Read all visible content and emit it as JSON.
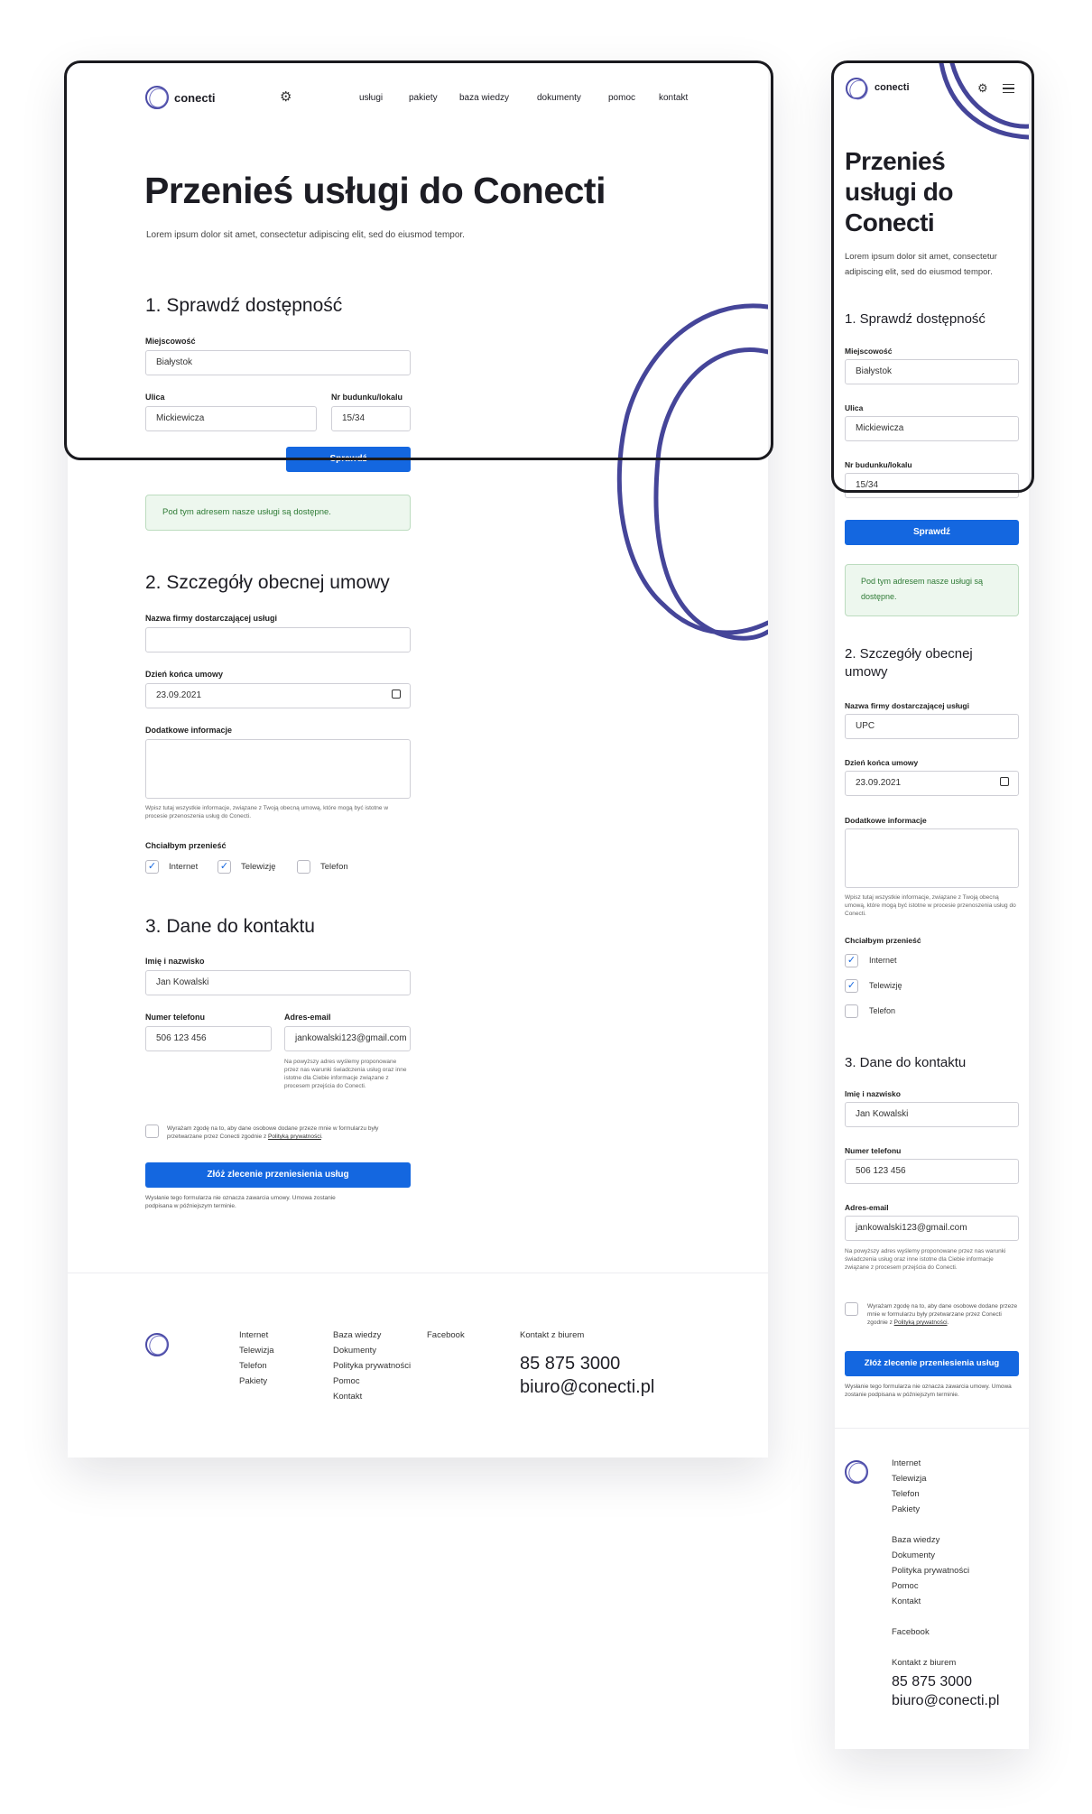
{
  "brand": {
    "name": "conecti",
    "accent": "#1467e0",
    "scribble": "#454599"
  },
  "nav": [
    "usługi",
    "pakiety",
    "baza wiedzy",
    "dokumenty",
    "pomoc",
    "kontakt"
  ],
  "icons": {
    "settings": "gear-icon",
    "menu": "hamburger-icon",
    "calendar": "calendar-icon"
  },
  "hero": {
    "title": "Przenieś usługi do Conecti",
    "lead": "Lorem ipsum dolor sit amet, consectetur adipiscing elit, sed do eiusmod tempor."
  },
  "section1": {
    "title": "1. Sprawdź dostępność",
    "city_label": "Miejscowość",
    "city_value": "Białystok",
    "street_label": "Ulica",
    "street_value": "Mickiewicza",
    "number_label": "Nr budunku/lokalu",
    "number_value": "15/34",
    "check_button": "Sprawdź",
    "success": "Pod tym adresem nasze usługi są dostępne."
  },
  "section2": {
    "title": "2. Szczegóły obecnej umowy",
    "provider_label": "Nazwa firmy dostarczającej usługi",
    "provider_value": "",
    "provider_value_mobile": "UPC",
    "end_label": "Dzień końca umowy",
    "end_value": "23.09.2021",
    "info_label": "Dodatkowe informacje",
    "info_help": "Wpisz tutaj wszystkie informacje, związane z Twoją obecną umową, które mogą być istotne w procesie przenoszenia usług do Conecti.",
    "transfer_label": "Chciałbym przenieść",
    "options": [
      {
        "label": "Internet",
        "checked": true
      },
      {
        "label": "Telewizję",
        "checked": true
      },
      {
        "label": "Telefon",
        "checked": false
      }
    ]
  },
  "section3": {
    "title": "3. Dane do kontaktu",
    "name_label": "Imię i nazwisko",
    "name_value": "Jan Kowalski",
    "phone_label": "Numer telefonu",
    "phone_value": "506 123 456",
    "email_label": "Adres-email",
    "email_value": "jankowalski123@gmail.com",
    "email_help": "Na powyższy adres wyślemy proponowane przez nas warunki świadczenia usług oraz inne istotne dla Ciebie informacje związane z procesem przejścia do Conecti.",
    "consent_prefix": "Wyrażam zgodę na to, aby dane osobowe dodane przeze mnie w formularzu były przetwarzane przez Conecti zgodnie z ",
    "consent_link": "Polityką prywatności",
    "consent_suffix": ".",
    "submit": "Złóż zlecenie przeniesienia usług",
    "note": "Wysłanie tego formularza nie oznacza zawarcia umowy. Umowa zostanie podpisana w późniejszym terminie."
  },
  "footer": {
    "col1": [
      "Internet",
      "Telewizja",
      "Telefon",
      "Pakiety"
    ],
    "col2": [
      "Baza wiedzy",
      "Dokumenty",
      "Polityka prywatności",
      "Pomoc",
      "Kontakt"
    ],
    "col3": [
      "Facebook"
    ],
    "contact_label": "Kontakt z biurem",
    "phone": "85 875 3000",
    "email": "biuro@conecti.pl"
  }
}
